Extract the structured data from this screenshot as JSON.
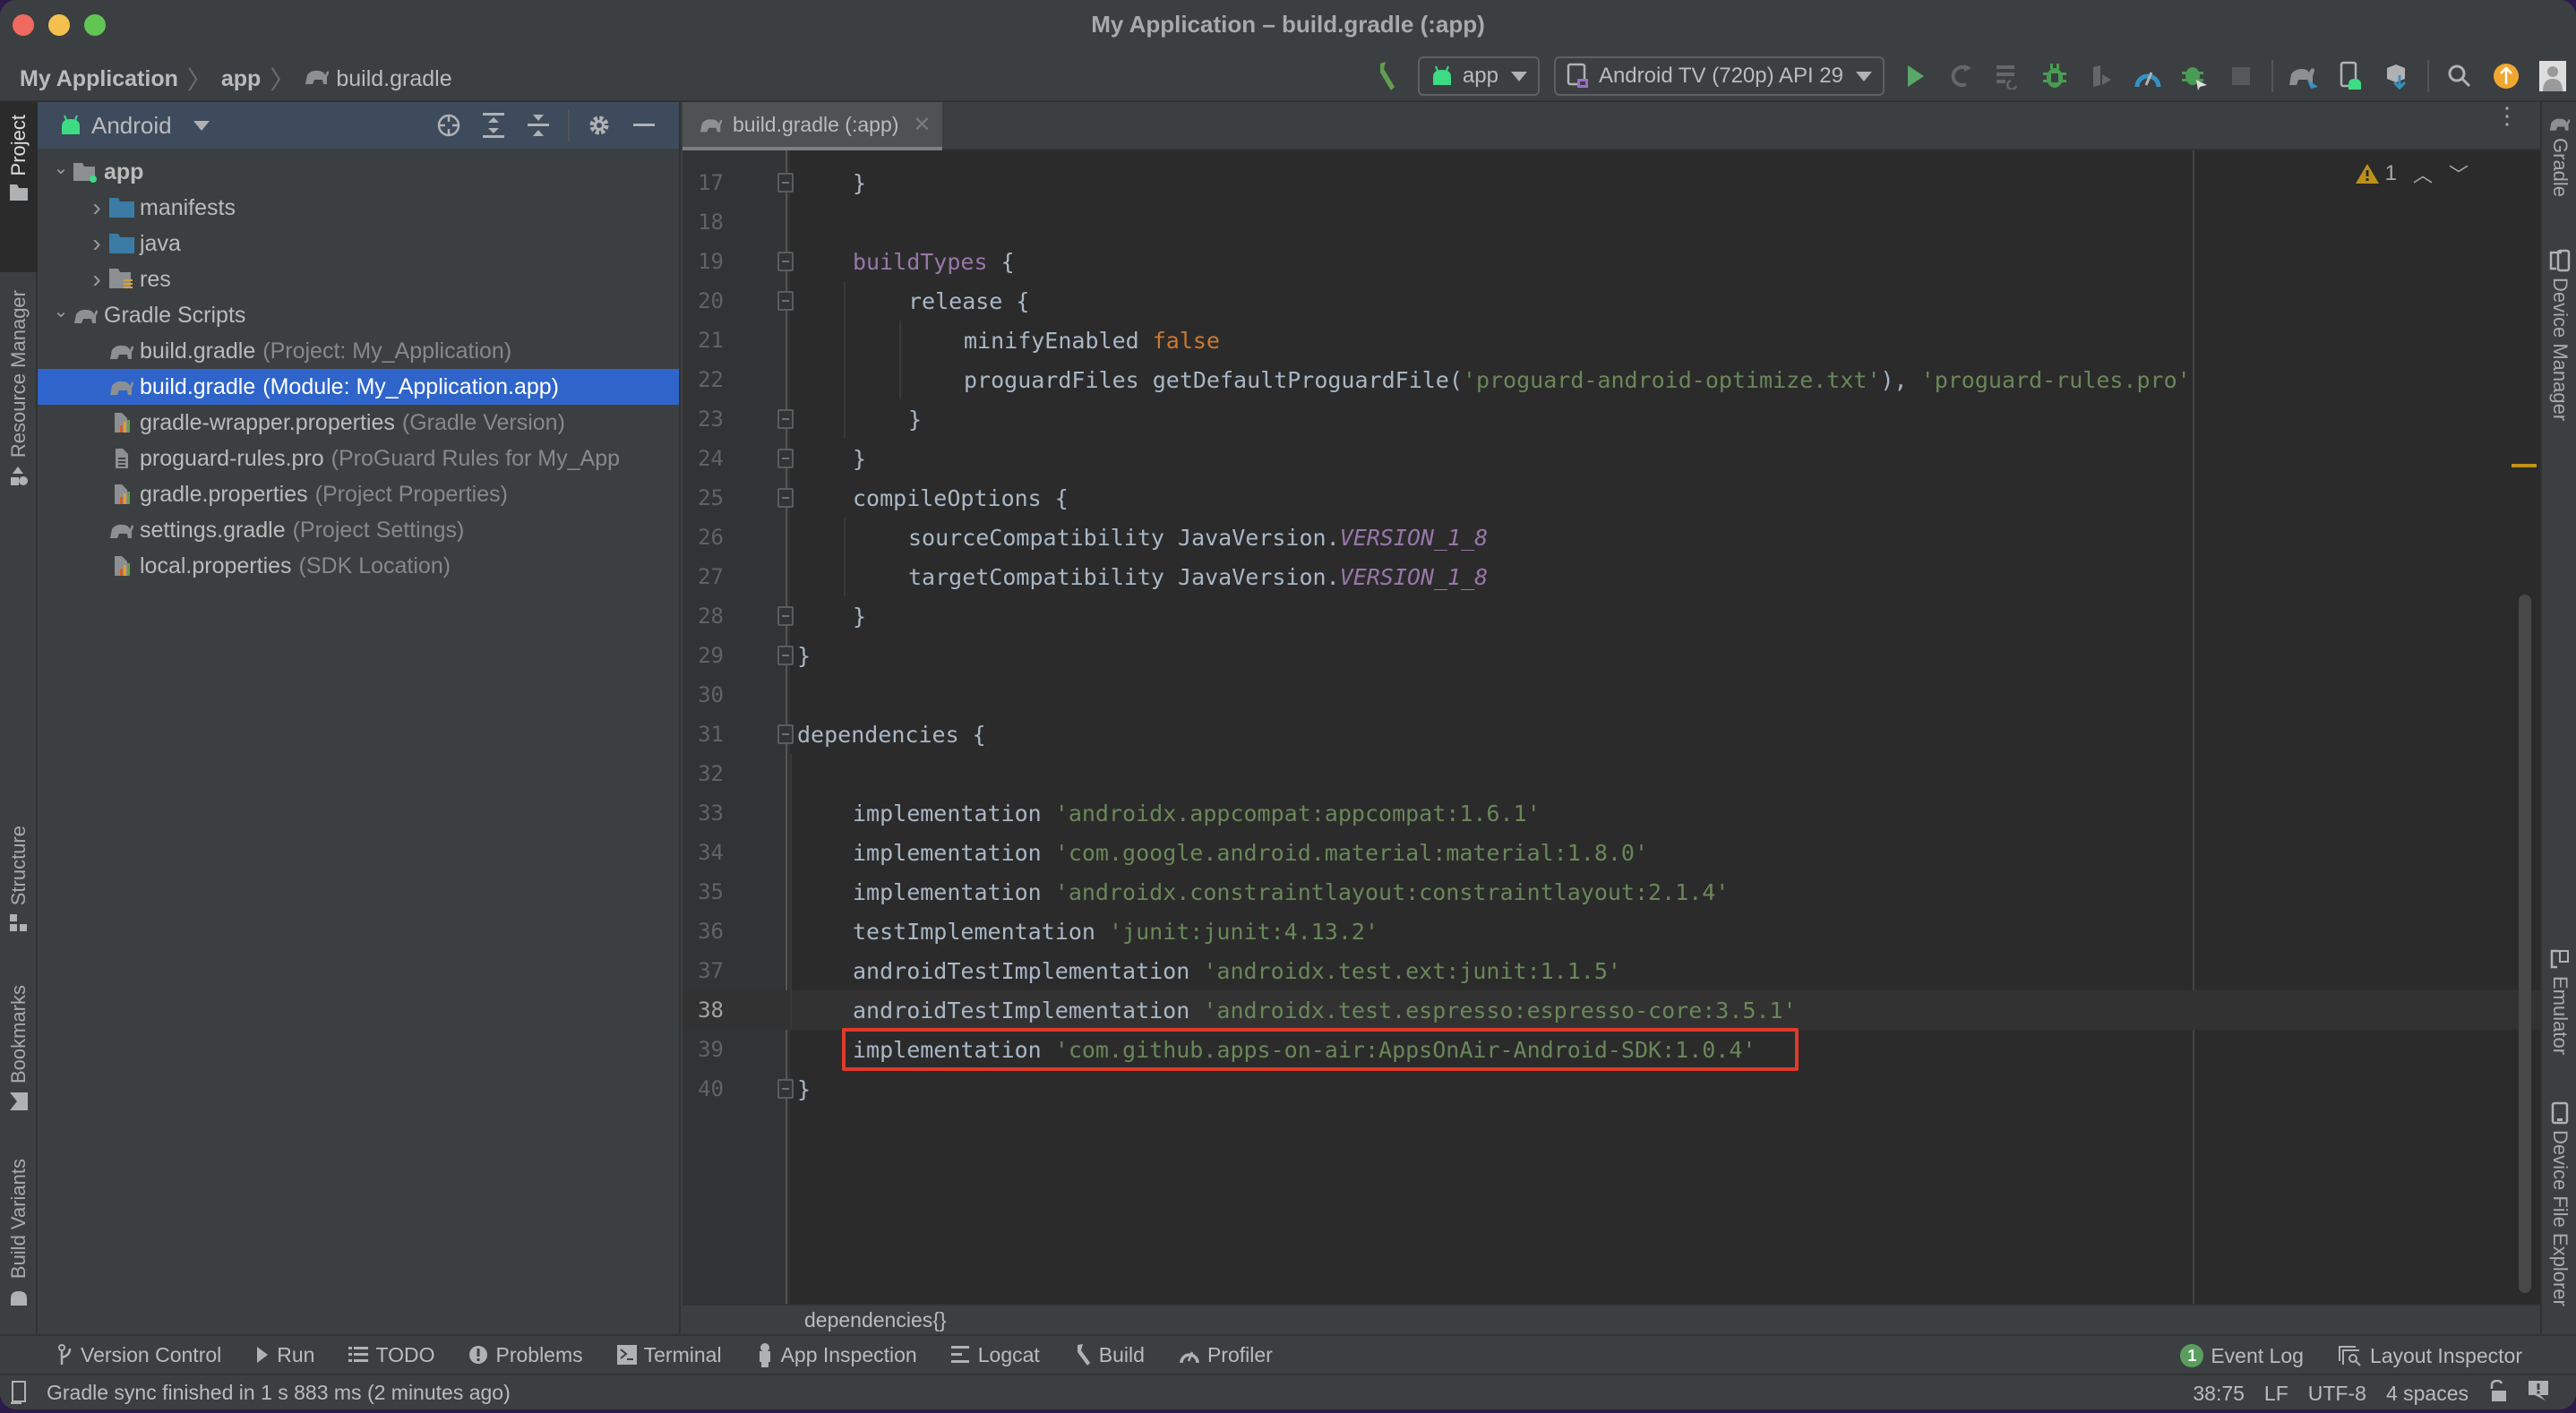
{
  "window": {
    "title": "My Application – build.gradle (:app)"
  },
  "navbar": {
    "breadcrumbs": [
      "My Application",
      "app",
      "build.gradle"
    ],
    "run_config": "app",
    "device": "Android TV (720p) API 29"
  },
  "toolbar_icons": [
    "hammer-icon",
    "run-icon",
    "apply-changes-icon",
    "apply-code-changes-icon",
    "debug-icon",
    "attach-debugger-icon",
    "profile-icon",
    "debug-attach-icon",
    "stop-icon",
    "sync-gradle-icon",
    "avd-manager-icon",
    "sdk-manager-icon",
    "search-icon",
    "update-icon",
    "account-icon"
  ],
  "left_strip": {
    "items": [
      "Project",
      "Resource Manager",
      "Structure",
      "Bookmarks",
      "Build Variants"
    ]
  },
  "right_strip": {
    "items": [
      "Gradle",
      "Device Manager",
      "Emulator",
      "Device File Explorer"
    ]
  },
  "project_panel": {
    "view_mode": "Android",
    "tree": [
      {
        "label": "app",
        "hint": "",
        "level": 0,
        "expanded": true,
        "icon": "module-folder-icon",
        "bold": true
      },
      {
        "label": "manifests",
        "hint": "",
        "level": 1,
        "expanded": false,
        "icon": "folder-icon"
      },
      {
        "label": "java",
        "hint": "",
        "level": 1,
        "expanded": false,
        "icon": "folder-icon"
      },
      {
        "label": "res",
        "hint": "",
        "level": 1,
        "expanded": false,
        "icon": "res-folder-icon"
      },
      {
        "label": "Gradle Scripts",
        "hint": "",
        "level": 0,
        "expanded": true,
        "icon": "gradle-icon"
      },
      {
        "label": "build.gradle",
        "hint": "(Project: My_Application)",
        "level": 1,
        "icon": "gradle-icon"
      },
      {
        "label": "build.gradle",
        "hint": "(Module: My_Application.app)",
        "level": 1,
        "icon": "gradle-icon",
        "selected": true
      },
      {
        "label": "gradle-wrapper.properties",
        "hint": "(Gradle Version)",
        "level": 1,
        "icon": "properties-icon"
      },
      {
        "label": "proguard-rules.pro",
        "hint": "(ProGuard Rules for My_App",
        "level": 1,
        "icon": "text-file-icon"
      },
      {
        "label": "gradle.properties",
        "hint": "(Project Properties)",
        "level": 1,
        "icon": "properties-icon"
      },
      {
        "label": "settings.gradle",
        "hint": "(Project Settings)",
        "level": 1,
        "icon": "gradle-icon"
      },
      {
        "label": "local.properties",
        "hint": "(SDK Location)",
        "level": 1,
        "icon": "properties-icon"
      }
    ]
  },
  "editor": {
    "tab_label": "build.gradle (:app)",
    "warning_count": "1",
    "current_line": 38,
    "highlighted_line": 39,
    "lines": [
      {
        "n": "17",
        "indent": 1,
        "tokens": [
          {
            "t": "}",
            "c": ""
          }
        ]
      },
      {
        "n": "18",
        "indent": 0,
        "tokens": []
      },
      {
        "n": "19",
        "indent": 1,
        "tokens": [
          {
            "t": "buildTypes",
            "c": "k-purple"
          },
          {
            "t": " {",
            "c": ""
          }
        ]
      },
      {
        "n": "20",
        "indent": 2,
        "tokens": [
          {
            "t": "release {",
            "c": ""
          }
        ]
      },
      {
        "n": "21",
        "indent": 3,
        "tokens": [
          {
            "t": "minifyEnabled ",
            "c": ""
          },
          {
            "t": "false",
            "c": "k-orange"
          }
        ]
      },
      {
        "n": "22",
        "indent": 3,
        "tokens": [
          {
            "t": "proguardFiles getDefaultProguardFile(",
            "c": ""
          },
          {
            "t": "'proguard-android-optimize.txt'",
            "c": "k-green"
          },
          {
            "t": "), ",
            "c": ""
          },
          {
            "t": "'proguard-rules.pro'",
            "c": "k-green"
          }
        ]
      },
      {
        "n": "23",
        "indent": 2,
        "tokens": [
          {
            "t": "}",
            "c": ""
          }
        ]
      },
      {
        "n": "24",
        "indent": 1,
        "tokens": [
          {
            "t": "}",
            "c": ""
          }
        ]
      },
      {
        "n": "25",
        "indent": 1,
        "tokens": [
          {
            "t": "compileOptions {",
            "c": ""
          }
        ]
      },
      {
        "n": "26",
        "indent": 2,
        "tokens": [
          {
            "t": "sourceCompatibility JavaVersion.",
            "c": ""
          },
          {
            "t": "VERSION_1_8",
            "c": "k-italic"
          }
        ]
      },
      {
        "n": "27",
        "indent": 2,
        "tokens": [
          {
            "t": "targetCompatibility JavaVersion.",
            "c": ""
          },
          {
            "t": "VERSION_1_8",
            "c": "k-italic"
          }
        ]
      },
      {
        "n": "28",
        "indent": 1,
        "tokens": [
          {
            "t": "}",
            "c": ""
          }
        ]
      },
      {
        "n": "29",
        "indent": 0,
        "tokens": [
          {
            "t": "}",
            "c": ""
          }
        ]
      },
      {
        "n": "30",
        "indent": 0,
        "tokens": []
      },
      {
        "n": "31",
        "indent": 0,
        "tokens": [
          {
            "t": "dependencies {",
            "c": ""
          }
        ]
      },
      {
        "n": "32",
        "indent": 0,
        "tokens": []
      },
      {
        "n": "33",
        "indent": 1,
        "tokens": [
          {
            "t": "implementation ",
            "c": ""
          },
          {
            "t": "'androidx.appcompat:appcompat:1.6.1'",
            "c": "k-green"
          }
        ]
      },
      {
        "n": "34",
        "indent": 1,
        "tokens": [
          {
            "t": "implementation ",
            "c": ""
          },
          {
            "t": "'com.google.android.material:material:1.8.0'",
            "c": "k-green"
          }
        ]
      },
      {
        "n": "35",
        "indent": 1,
        "tokens": [
          {
            "t": "implementation ",
            "c": ""
          },
          {
            "t": "'androidx.constraintlayout:constraintlayout:2.1.4'",
            "c": "k-green"
          }
        ]
      },
      {
        "n": "36",
        "indent": 1,
        "tokens": [
          {
            "t": "testImplementation ",
            "c": ""
          },
          {
            "t": "'junit:junit:4.13.2'",
            "c": "k-green"
          }
        ]
      },
      {
        "n": "37",
        "indent": 1,
        "tokens": [
          {
            "t": "androidTestImplementation ",
            "c": ""
          },
          {
            "t": "'androidx.test.ext:junit:1.1.5'",
            "c": "k-green"
          }
        ]
      },
      {
        "n": "38",
        "indent": 1,
        "tokens": [
          {
            "t": "androidTestImplementation ",
            "c": ""
          },
          {
            "t": "'androidx.test.espresso:espresso-core:3.5.1'",
            "c": "k-green"
          }
        ]
      },
      {
        "n": "39",
        "indent": 1,
        "tokens": [
          {
            "t": "implementation ",
            "c": ""
          },
          {
            "t": "'com.github.apps-on-air:AppsOnAir-Android-SDK:1.0.4'",
            "c": "k-green"
          }
        ]
      },
      {
        "n": "40",
        "indent": 0,
        "tokens": [
          {
            "t": "}",
            "c": ""
          }
        ]
      }
    ],
    "fold_markers": [
      "17",
      "19",
      "20",
      "23",
      "24",
      "25",
      "28",
      "29",
      "31",
      "40"
    ],
    "breadcrumb": "dependencies{}"
  },
  "bottom_tools": {
    "left": [
      {
        "label": "Version Control",
        "icon": "git-branch-icon"
      },
      {
        "label": "Run",
        "icon": "run-icon"
      },
      {
        "label": "TODO",
        "icon": "list-icon"
      },
      {
        "label": "Problems",
        "icon": "problems-icon"
      },
      {
        "label": "Terminal",
        "icon": "terminal-icon"
      },
      {
        "label": "App Inspection",
        "icon": "app-inspection-icon"
      },
      {
        "label": "Logcat",
        "icon": "logcat-icon"
      },
      {
        "label": "Build",
        "icon": "hammer-icon"
      },
      {
        "label": "Profiler",
        "icon": "profiler-icon"
      }
    ],
    "event_log_label": "Event Log",
    "event_log_count": "1",
    "layout_inspector_label": "Layout Inspector"
  },
  "status_bar": {
    "message": "Gradle sync finished in 1 s 883 ms (2 minutes ago)",
    "position": "38:75",
    "line_separator": "LF",
    "encoding": "UTF-8",
    "indent": "4 spaces"
  },
  "colors": {
    "selection": "#2f65ca",
    "highlight_box": "#e03a2a",
    "warning": "#be9117",
    "string": "#6a8759",
    "keyword": "#cc7832",
    "field": "#9876aa",
    "android_green": "#3ddc84"
  }
}
